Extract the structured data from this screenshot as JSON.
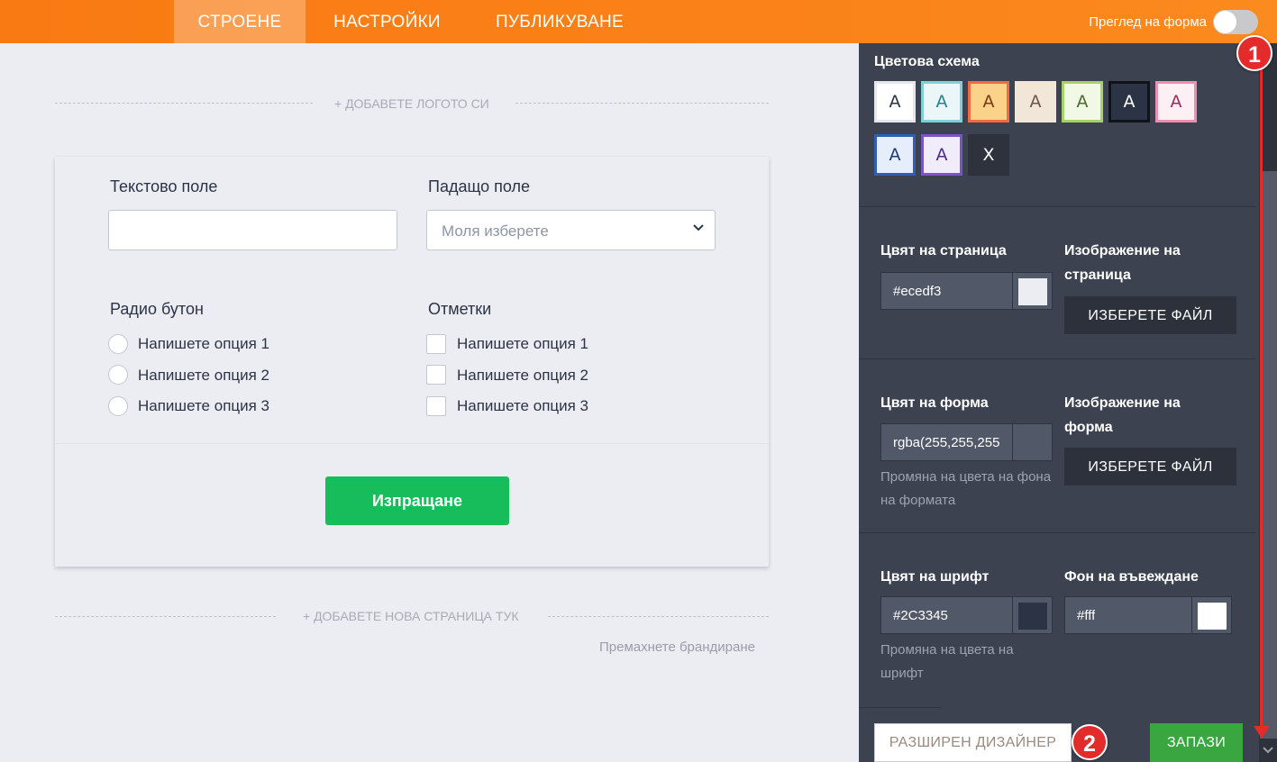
{
  "topbar": {
    "tabs": [
      {
        "label": "СТРОЕНЕ",
        "active": true
      },
      {
        "label": "НАСТРОЙКИ",
        "active": false
      },
      {
        "label": "ПУБЛИКУВАНЕ",
        "active": false
      }
    ],
    "preview_label": "Преглед на форма",
    "preview_on": false
  },
  "builder": {
    "add_logo": "+ ДОБАВЕТЕ ЛОГОТО СИ",
    "add_page": "+ ДОБАВЕТЕ НОВА СТРАНИЦА ТУК",
    "remove_branding": "Премахнете брандиране",
    "form": {
      "text_field_label": "Текстово поле",
      "dropdown_label": "Падащо поле",
      "dropdown_placeholder": "Моля изберете",
      "radio_label": "Радио бутон",
      "checkbox_label": "Отметки",
      "radio_options": [
        "Напишете опция 1",
        "Напишете опция 2",
        "Напишете опция 3"
      ],
      "checkbox_options": [
        "Напишете опция 1",
        "Напишете опция 2",
        "Напишете опция 3"
      ],
      "submit_label": "Изпращане"
    }
  },
  "panel": {
    "scheme_title": "Цветова схема",
    "schemes": [
      {
        "letter": "A",
        "bg": "#ffffff",
        "border": "#e6e7ec",
        "text": "#2c3345"
      },
      {
        "letter": "A",
        "bg": "#eaf6f7",
        "border": "#7fd0d8",
        "text": "#2b7f8c"
      },
      {
        "letter": "A",
        "bg": "#fbd28a",
        "border": "#f26a3d",
        "text": "#7a3a13"
      },
      {
        "letter": "A",
        "bg": "#f1e6d8",
        "border": "#f1e6d8",
        "text": "#6b5646"
      },
      {
        "letter": "A",
        "bg": "#f1f8e6",
        "border": "#a5d36a",
        "text": "#4d6b2a"
      },
      {
        "letter": "A",
        "bg": "#2c3345",
        "border": "#111318",
        "text": "#ffffff"
      },
      {
        "letter": "A",
        "bg": "#fdf0f4",
        "border": "#ef8fae",
        "text": "#9b2d55"
      },
      {
        "letter": "A",
        "bg": "#e6eefb",
        "border": "#2f5fb3",
        "text": "#1e3a78"
      },
      {
        "letter": "A",
        "bg": "#f1ecfa",
        "border": "#7b55c7",
        "text": "#4c2d8c"
      },
      {
        "letter": "X",
        "bg": "#2d323c",
        "border": "#2d323c",
        "text": "#ffffff"
      }
    ],
    "page_color_label": "Цвят на страница",
    "page_color_value": "#ecedf3",
    "page_color_swatch": "#ecedf3",
    "page_image_label": "Изображение на страница",
    "choose_file": "ИЗБЕРЕТЕ ФАЙЛ",
    "form_color_label": "Цвят на форма",
    "form_color_value": "rgba(255,255,255",
    "form_color_hint": "Промяна на цвета на фона на формата",
    "form_image_label": "Изображение на форма",
    "font_color_label": "Цвят на шрифт",
    "font_color_value": "#2C3345",
    "font_color_swatch": "#2c3345",
    "font_color_hint": "Промяна на цвета на шрифт",
    "input_bg_label": "Фон на въвеждане",
    "input_bg_value": "#fff",
    "input_bg_swatch": "#ffffff",
    "advanced_designer": "РАЗШИРЕН ДИЗАЙНЕР",
    "save": "ЗАПАЗИ"
  },
  "annotations": {
    "badge1": "1",
    "badge2": "2"
  }
}
